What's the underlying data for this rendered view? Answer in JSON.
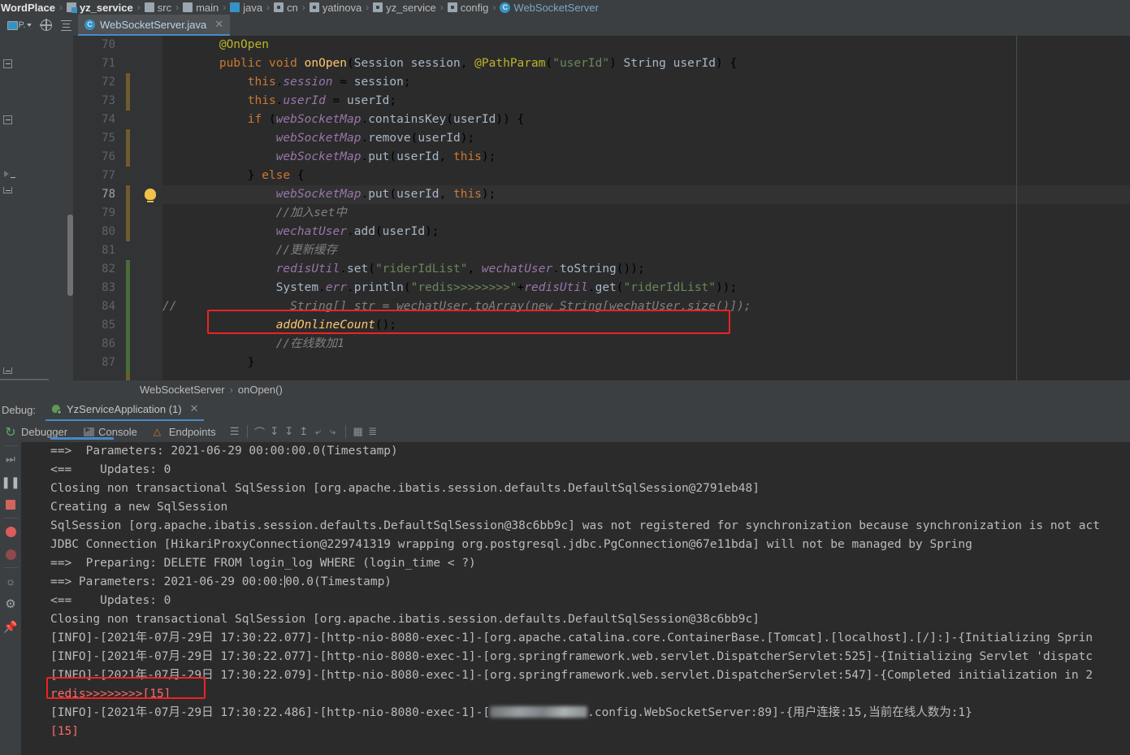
{
  "navbar": {
    "crumbs": [
      {
        "label": "WordPlace",
        "icon": "none",
        "bold": true
      },
      {
        "label": "yz_service",
        "icon": "module-icon",
        "bold": true
      },
      {
        "label": "src",
        "icon": "folder-icon",
        "bold": false
      },
      {
        "label": "main",
        "icon": "folder-icon",
        "bold": false
      },
      {
        "label": "java",
        "icon": "source-root-icon",
        "bold": false
      },
      {
        "label": "cn",
        "icon": "package-icon",
        "bold": false
      },
      {
        "label": "yatinova",
        "icon": "package-icon",
        "bold": false
      },
      {
        "label": "yz_service",
        "icon": "package-icon",
        "bold": false
      },
      {
        "label": "config",
        "icon": "package-icon",
        "bold": false
      },
      {
        "label": "WebSocketServer",
        "icon": "class-icon",
        "bold": false,
        "is_class": true
      }
    ],
    "separator": "›",
    "class_glyph": "C"
  },
  "toolstrip": {
    "project_label": "P.",
    "buttons": [
      "project-window-button",
      "locate-file-button",
      "collapse-all-button"
    ]
  },
  "editor_tab": {
    "label": "WebSocketServer.java",
    "icon_glyph": "C",
    "close_glyph": "✕"
  },
  "editor": {
    "first_line": 70,
    "current_line": 78,
    "right_margin_col": true,
    "lines": [
      {
        "n": 70,
        "html": "        <span class='t-ann'>@OnOpen</span>"
      },
      {
        "n": 71,
        "html": "        <span class='t-kw'>public</span> <span class='t-kw'>void</span> <span class='t-mth'>onOpen</span>(<span class='t-def'>Session session</span>, <span class='t-ann'>@PathParam</span>(<span class='t-str'>\"userId\"</span>) <span class='t-def'>String userId</span>) {"
      },
      {
        "n": 72,
        "html": "            <span class='t-kw'>this</span>.<span class='t-fld'>session</span> = <span class='t-def'>session</span>;"
      },
      {
        "n": 73,
        "html": "            <span class='t-kw'>this</span>.<span class='t-fld'>userId</span> = <span class='t-def'>userId</span>;"
      },
      {
        "n": 74,
        "html": "            <span class='t-kw'>if</span> (<span class='t-fld'>webSocketMap</span>.<span class='t-def'>containsKey</span>(<span class='t-def'>userId</span>)) {"
      },
      {
        "n": 75,
        "html": "                <span class='t-fld'>webSocketMap</span>.<span class='t-def'>remove</span>(<span class='t-def'>userId</span>);"
      },
      {
        "n": 76,
        "html": "                <span class='t-fld'>webSocketMap</span>.<span class='t-def'>put</span>(<span class='t-def'>userId</span>, <span class='t-kw'>this</span>);"
      },
      {
        "n": 77,
        "html": "            } <span class='t-kw'>else</span> {"
      },
      {
        "n": 78,
        "html": "                <span class='t-fld'>webSocketMap</span>.<span class='t-def'>put</span>(<span class='t-def'>userId</span>, <span class='t-kw'>this</span>);"
      },
      {
        "n": 79,
        "html": "                <span class='t-cmt'>//加入set中</span>"
      },
      {
        "n": 80,
        "html": "                <span class='t-fld'>wechatUser</span>.<span class='t-def'>add</span>(<span class='t-def'>userId</span>);"
      },
      {
        "n": 81,
        "html": "                <span class='t-cmt'>//更新缓存</span>"
      },
      {
        "n": 82,
        "html": "                <span class='t-fld'>redisUtil</span>.<span class='t-def'>set</span>(<span class='t-str'>\"riderIdList\"</span>, <span class='t-fld'>wechatUser</span>.<span class='t-def'>toString</span>());"
      },
      {
        "n": 83,
        "html": "                <span class='t-def'>System</span>.<span class='t-stfld'>err</span>.<span class='t-def'>println</span>(<span class='t-str'>\"redis&gt;&gt;&gt;&gt;&gt;&gt;&gt;&gt;\"</span>+<span class='t-fld'>redisUtil</span>.<span class='t-def'>get</span>(<span class='t-str'>\"riderIdList\"</span>));"
      },
      {
        "n": 84,
        "html": "<span class='t-cmt'>//                String[] str = wechatUser.toArray(new String[wechatUser.size()]);</span>"
      },
      {
        "n": 85,
        "html": "                <span class='t-static-m' style='color:#ffc66d'>addOnlineCount</span>();"
      },
      {
        "n": 86,
        "html": "                <span class='t-cmt'>//在线数加1</span>"
      },
      {
        "n": 87,
        "html": "            }"
      }
    ],
    "highlight_box": {
      "line": 83,
      "color": "#ee2222",
      "label": "code-highlight-box"
    }
  },
  "editor_breadcrumb": {
    "items": [
      "WebSocketServer",
      "onOpen()"
    ],
    "separator": "›"
  },
  "debug_header": {
    "label": "Debug:",
    "run_config": "YzServiceApplication (1)",
    "close_glyph": "✕"
  },
  "debug_toolbar": {
    "tabs": [
      {
        "label": "Debugger",
        "icon": "debugger-icon"
      },
      {
        "label": "Console",
        "icon": "console-icon"
      },
      {
        "label": "Endpoints",
        "icon": "endpoints-icon"
      }
    ],
    "icons": [
      "layout-settings-icon",
      "step-over-icon",
      "step-into-icon",
      "force-step-into-icon",
      "step-out-icon",
      "drop-frame-icon",
      "run-to-cursor-icon",
      "evaluate-expression-icon",
      "settings-icon"
    ]
  },
  "debug_rail": {
    "icons": [
      "rerun-icon",
      "resume-program-icon",
      "pause-program-icon",
      "stop-icon",
      "view-breakpoints-icon",
      "mute-breakpoints-icon",
      "screenshot-icon",
      "settings-gear-icon",
      "pin-tab-icon"
    ]
  },
  "console": {
    "lines": [
      {
        "text": "==>  Parameters: 2021-06-29 00:00:00.0(Timestamp)",
        "type": "out"
      },
      {
        "text": "<==    Updates: 0",
        "type": "out"
      },
      {
        "text": "Closing non transactional SqlSession [org.apache.ibatis.session.defaults.DefaultSqlSession@2791eb48]",
        "type": "out"
      },
      {
        "text": "Creating a new SqlSession",
        "type": "out"
      },
      {
        "text": "SqlSession [org.apache.ibatis.session.defaults.DefaultSqlSession@38c6bb9c] was not registered for synchronization because synchronization is not act",
        "type": "out"
      },
      {
        "text": "JDBC Connection [HikariProxyConnection@229741319 wrapping org.postgresql.jdbc.PgConnection@67e11bda] will not be managed by Spring",
        "type": "out"
      },
      {
        "text": "==>  Preparing: DELETE FROM login_log WHERE (login_time < ?)",
        "type": "out"
      },
      {
        "text": "==> Parameters: 2021-06-29 00:00:00.0(Timestamp)",
        "type": "out",
        "has_caret": true
      },
      {
        "text": "<==    Updates: 0",
        "type": "out"
      },
      {
        "text": "Closing non transactional SqlSession [org.apache.ibatis.session.defaults.DefaultSqlSession@38c6bb9c]",
        "type": "out"
      },
      {
        "text": "[INFO]-[2021年-07月-29日 17:30:22.077]-[http-nio-8080-exec-1]-[org.apache.catalina.core.ContainerBase.[Tomcat].[localhost].[/]:]-{Initializing Sprin",
        "type": "out"
      },
      {
        "text": "[INFO]-[2021年-07月-29日 17:30:22.077]-[http-nio-8080-exec-1]-[org.springframework.web.servlet.DispatcherServlet:525]-{Initializing Servlet 'dispatc",
        "type": "out"
      },
      {
        "text": "[INFO]-[2021年-07月-29日 17:30:22.079]-[http-nio-8080-exec-1]-[org.springframework.web.servlet.DispatcherServlet:547]-{Completed initialization in 2",
        "type": "out"
      },
      {
        "text": "redis>>>>>>>>[15]",
        "type": "err"
      },
      {
        "text": "[INFO]-[2021年-07月-29日 17:30:22.486]-[http-nio-8080-exec-1]-[",
        "type": "out",
        "redacted": true,
        "suffix": ".config.WebSocketServer:89]-{用户连接:15,当前在线人数为:1}"
      },
      {
        "text": "[15]",
        "type": "err"
      }
    ],
    "highlight_box": {
      "line_text": "redis>>>>>>>>[15]",
      "color": "#ee2222",
      "label": "console-highlight-box"
    }
  },
  "colors": {
    "ide_chrome": "#3c3f41",
    "editor_bg": "#2b2b2b",
    "gutter_bg": "#313335",
    "accent_blue": "#4a88c7",
    "highlight_red": "#ee2222",
    "stderr_red": "#ff6b68",
    "keyword_orange": "#cc7832",
    "string_green": "#6a8759",
    "field_purple": "#9876aa",
    "annotation_yellow": "#bbb529",
    "method_yellow": "#ffc66d",
    "comment_gray": "#808080"
  }
}
